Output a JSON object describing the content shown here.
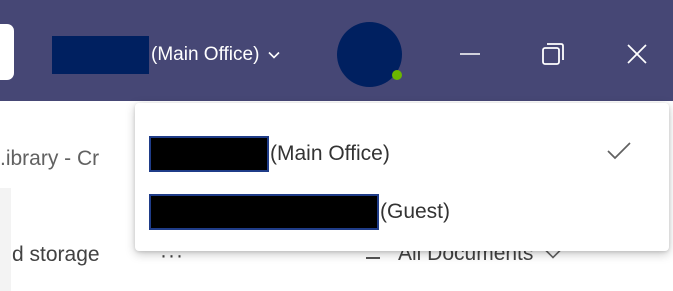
{
  "titlebar": {
    "tenant_label": "(Main Office)",
    "background_color": "#464775",
    "window_controls": [
      "minimize-icon",
      "restore-icon",
      "close-icon"
    ]
  },
  "account_menu": {
    "items": [
      {
        "label": "(Main Office)",
        "selected": true,
        "icon": "check-icon"
      },
      {
        "label": "(Guest)",
        "selected": false
      }
    ]
  },
  "page": {
    "breadcrumb_partial": ".ibrary - Cr",
    "storage_partial": "d storage",
    "more_label": "···",
    "view_label": "All Documents",
    "view_icon": "view-options-icon"
  },
  "colors": {
    "redaction_fill": "#002060",
    "presence": "#6bb700",
    "accent": "#464775"
  }
}
